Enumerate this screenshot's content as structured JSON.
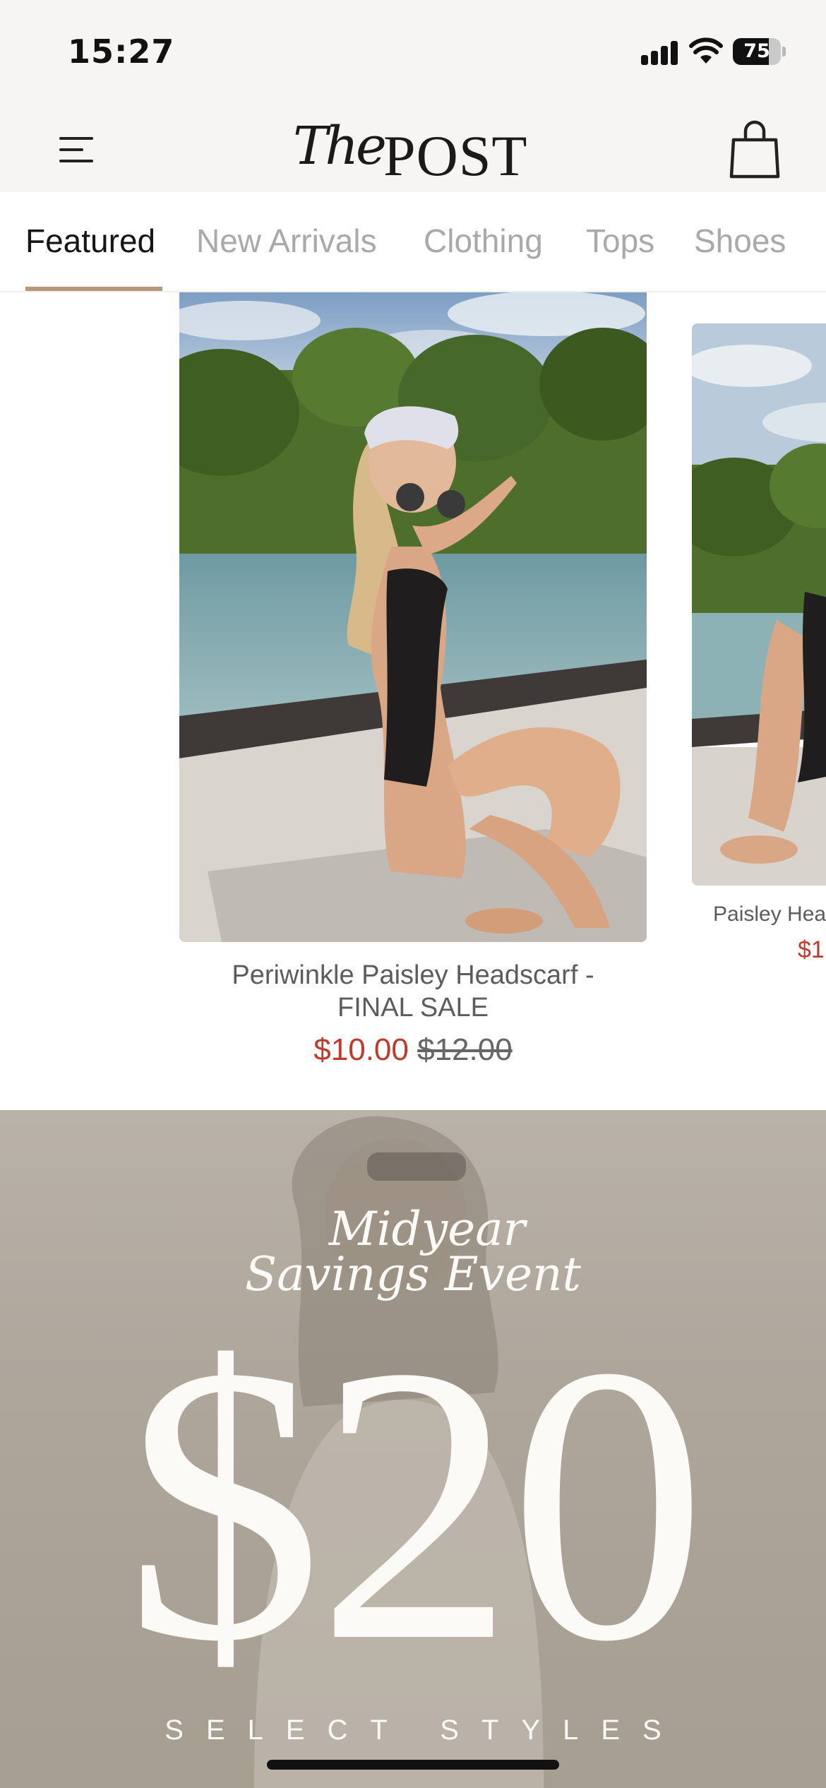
{
  "status_bar": {
    "time": "15:27",
    "battery_percent": "75",
    "battery_level": 0.75,
    "icons": [
      "signal-icon",
      "wifi-icon",
      "battery-icon"
    ]
  },
  "header": {
    "logo_script": "The",
    "logo_word": "POST",
    "icons": [
      "menu-icon",
      "shopping-bag-icon"
    ]
  },
  "tabs": [
    {
      "label": "Featured",
      "active": true
    },
    {
      "label": "New Arrivals",
      "active": false
    },
    {
      "label": "Clothing",
      "active": false
    },
    {
      "label": "Tops",
      "active": false
    },
    {
      "label": "Shoes",
      "active": false
    }
  ],
  "products": [
    {
      "title_line1": "Periwinkle Paisley Headscarf -",
      "title_line2": "FINAL SALE",
      "sale_price": "$10.00",
      "original_price": "$12.00"
    },
    {
      "title_line1": "Paisley Hea",
      "sale_price": "$1("
    }
  ],
  "promo": {
    "script_line1": "Midyear",
    "script_line2": "Savings Event",
    "headline": "$20",
    "subline": "SELECT STYLES"
  },
  "colors": {
    "accent_underline": "#b79776",
    "sale_red": "#c0392b",
    "header_bg": "#f6f5f3",
    "inactive_tab": "#a9a9a9"
  }
}
